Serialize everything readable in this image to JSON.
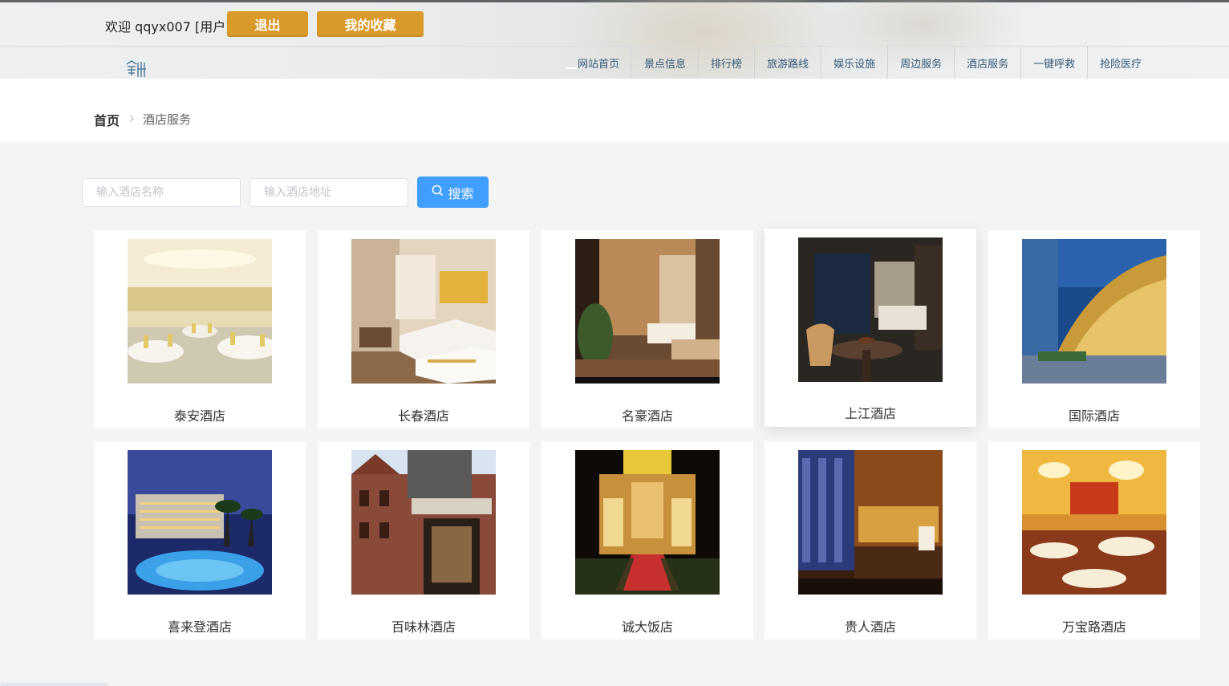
{
  "header": {
    "welcome": "欢迎 qqyx007 [用户]",
    "logout_label": "退出",
    "favorites_label": "我的收藏"
  },
  "nav": {
    "items": [
      "网站首页",
      "景点信息",
      "排行榜",
      "旅游路线",
      "娱乐设施",
      "周边服务",
      "酒店服务",
      "一键呼救",
      "抢险医疗"
    ]
  },
  "breadcrumb": {
    "home": "首页",
    "current": "酒店服务"
  },
  "search": {
    "name_placeholder": "输入酒店名称",
    "address_placeholder": "输入酒店地址",
    "button_label": "搜索"
  },
  "hotels": [
    {
      "name": "泰安酒店"
    },
    {
      "name": "长春酒店"
    },
    {
      "name": "名豪酒店"
    },
    {
      "name": "上江酒店"
    },
    {
      "name": "国际酒店"
    },
    {
      "name": "喜来登酒店"
    },
    {
      "name": "百味林酒店"
    },
    {
      "name": "诚大饭店"
    },
    {
      "name": "贵人酒店"
    },
    {
      "name": "万宝路酒店"
    }
  ],
  "colors": {
    "gold_button": "#d99a2c",
    "search_button": "#409eff",
    "nav_text": "#355a7a"
  }
}
